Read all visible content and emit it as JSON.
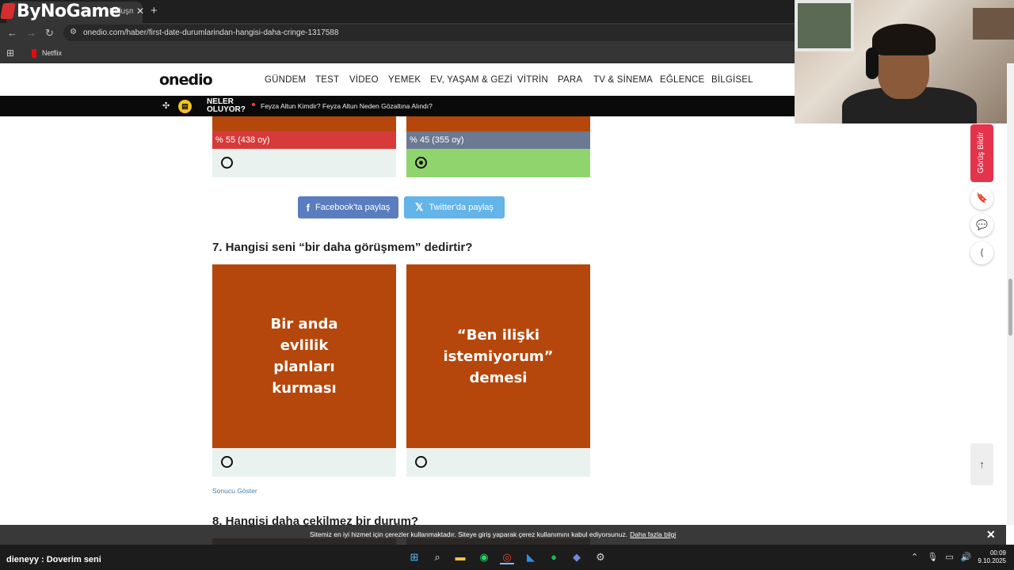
{
  "browser": {
    "tab_title": "Buluşm",
    "overlay_logo": "ByNoGame",
    "url": "onedio.com/haber/first-date-durumlarindan-hangisi-daha-cringe-1317588",
    "bookmark": "Netflix"
  },
  "site": {
    "logo": "onedio",
    "nav": [
      "GÜNDEM",
      "TEST",
      "VİDEO",
      "YEMEK",
      "EV, YAŞAM & GEZİ",
      "VİTRİN",
      "PARA",
      "TV & SİNEMA",
      "EĞLENCE",
      "BİLGİSEL"
    ],
    "ticker_label": "NELER OLUYOR?",
    "ticker_headline": "Feyza Altun Kimdir? Feyza Altun Neden Gözaltına Alındı?"
  },
  "poll6": {
    "left_result": "% 55 (438 oy)",
    "left_percent": 55,
    "right_result": "% 45 (355 oy)",
    "right_percent": 45,
    "selected": "right"
  },
  "share": {
    "facebook": "Facebook'ta paylaş",
    "twitter": "Twitter'da paylaş"
  },
  "q7": {
    "title": "7. Hangisi seni “bir daha görüşmem” dedirtir?",
    "option_a": "Bir anda\nevlilik\nplanları\nkurması",
    "option_b": "“Ben ilişki\nistemiyorum”\ndemesi",
    "show_result": "Sonucu Göster"
  },
  "q8": {
    "title": "8. Hangisi daha çekilmez bir durum?"
  },
  "sidebar": {
    "feedback": "Görüş Bildir"
  },
  "cookie": {
    "text": "Sitemiz en iyi hizmet için çerezler kullanmaktadır. Siteye giriş yaparak çerez kullanımını kabul ediyorsunuz.",
    "link": "Daha fazla bilgi"
  },
  "stream": {
    "chat_message": "dieneyy : Doverim seni"
  },
  "taskbar": {
    "time": "00:09",
    "date": "9.10.2025"
  },
  "colors": {
    "orange_card": "#b5470c",
    "result_red": "#d63a3a",
    "result_gray": "#6b7993",
    "selected_green": "#90d46e",
    "facebook_blue": "#5a7dbf",
    "twitter_blue": "#63b4e8",
    "feedback_red": "#e5334b"
  }
}
